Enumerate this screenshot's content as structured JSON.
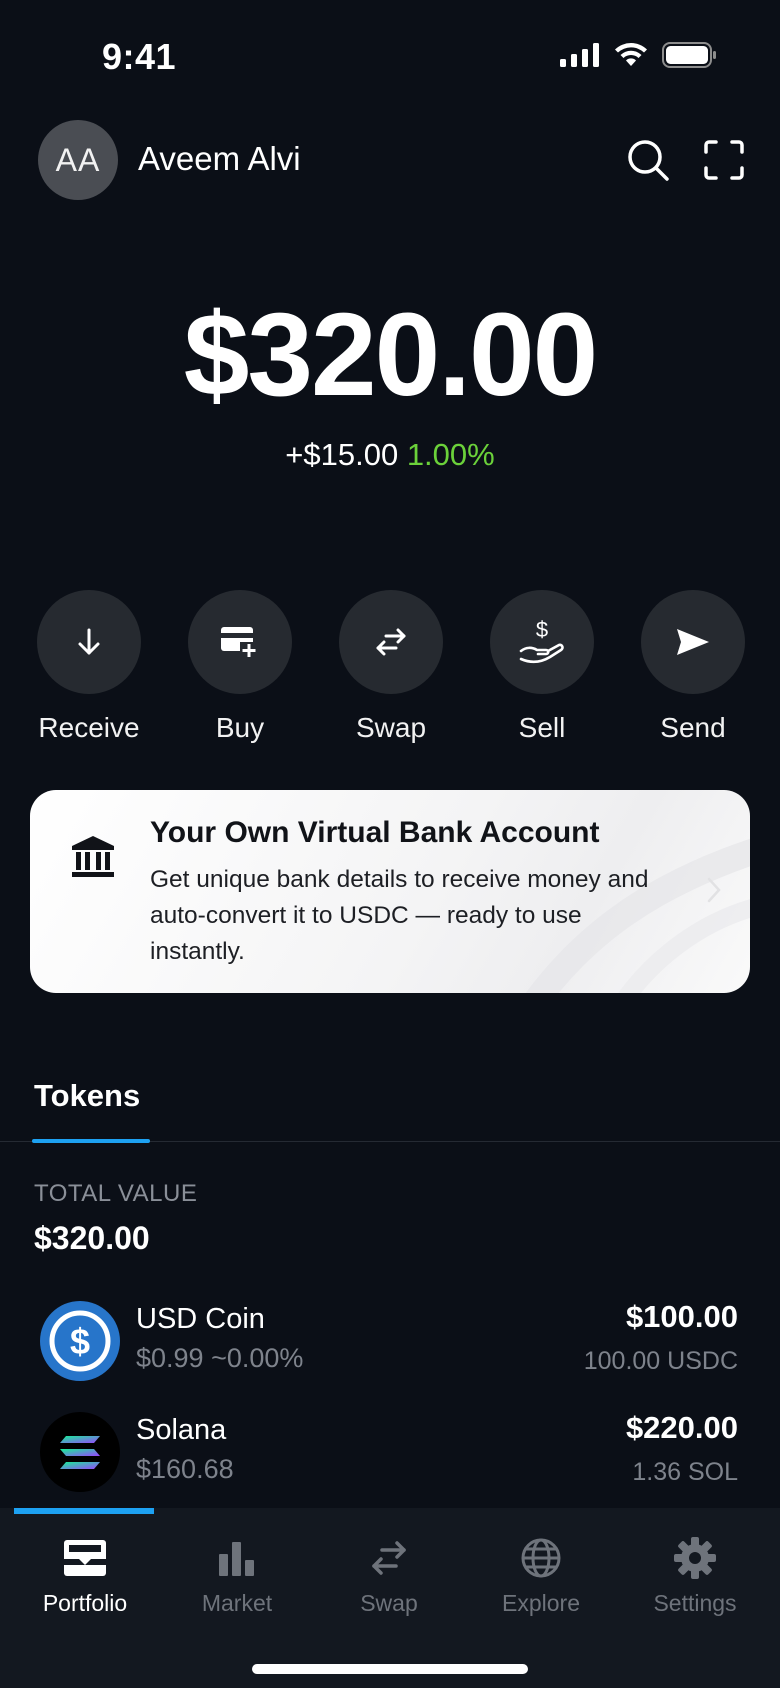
{
  "status_bar": {
    "time": "9:41"
  },
  "header": {
    "avatar_initials": "AA",
    "user_name": "Aveem Alvi"
  },
  "balance": {
    "total": "$320.00",
    "change_amount": "+$15.00",
    "change_percent": "1.00%"
  },
  "actions": [
    {
      "label": "Receive",
      "icon": "arrow-down-icon"
    },
    {
      "label": "Buy",
      "icon": "card-plus-icon"
    },
    {
      "label": "Swap",
      "icon": "swap-arrows-icon"
    },
    {
      "label": "Sell",
      "icon": "hand-dollar-icon"
    },
    {
      "label": "Send",
      "icon": "send-icon"
    }
  ],
  "promo": {
    "title": "Your Own Virtual Bank Account",
    "description": "Get unique bank details to receive money and auto-convert it to USDC — ready to use instantly.",
    "icon": "bank-icon"
  },
  "tabs": {
    "tokens": "Tokens"
  },
  "portfolio": {
    "total_label": "TOTAL VALUE",
    "total_value": "$320.00"
  },
  "tokens": [
    {
      "name": "USD Coin",
      "price": "$0.99 ~0.00%",
      "value": "$100.00",
      "amount": "100.00 USDC",
      "icon": "usdc-icon"
    },
    {
      "name": "Solana",
      "price": "$160.68",
      "value": "$220.00",
      "amount": "1.36 SOL",
      "icon": "solana-icon"
    }
  ],
  "bottom_nav": [
    {
      "label": "Portfolio",
      "icon": "wallet-icon",
      "active": true
    },
    {
      "label": "Market",
      "icon": "bar-chart-icon",
      "active": false
    },
    {
      "label": "Swap",
      "icon": "swap-arrows-icon",
      "active": false
    },
    {
      "label": "Explore",
      "icon": "globe-icon",
      "active": false
    },
    {
      "label": "Settings",
      "icon": "gear-icon",
      "active": false
    }
  ],
  "colors": {
    "background": "#0b0f17",
    "positive": "#6bd13a",
    "accent": "#1da1f2"
  }
}
